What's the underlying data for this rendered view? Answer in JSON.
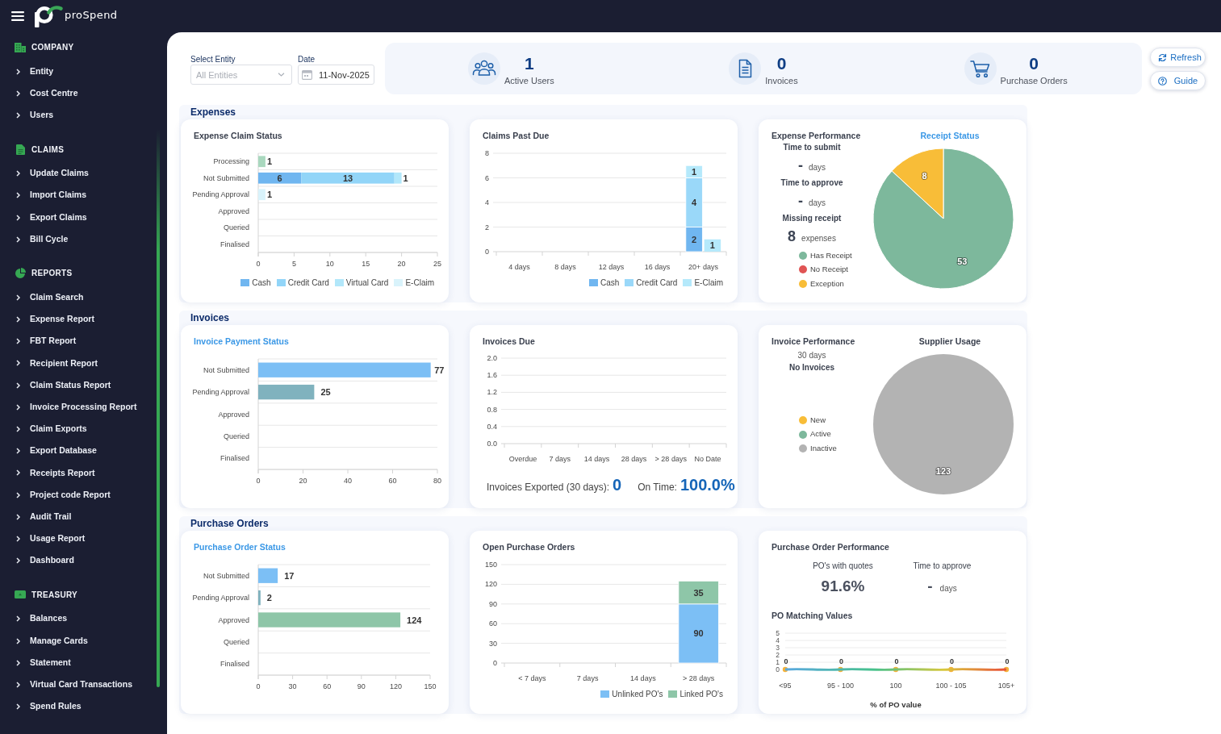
{
  "topbar": {
    "logo_text": "proSpend"
  },
  "sidebar": {
    "sections": [
      {
        "kind": "building",
        "title": "COMPANY",
        "items": [
          "Entity",
          "Cost Centre",
          "Users"
        ]
      },
      {
        "kind": "document",
        "title": "CLAIMS",
        "items": [
          "Update Claims",
          "Import Claims",
          "Export Claims",
          "Bill Cycle"
        ]
      },
      {
        "kind": "pie",
        "title": "REPORTS",
        "items": [
          "Claim Search",
          "Expense Report",
          "FBT Report",
          "Recipient Report",
          "Claim Status Report",
          "Invoice Processing Report",
          "Claim Exports",
          "Export Database",
          "Receipts Report",
          "Project code Report",
          "Audit Trail",
          "Usage Report",
          "Dashboard"
        ]
      },
      {
        "kind": "money",
        "title": "TREASURY",
        "items": [
          "Balances",
          "Manage Cards",
          "Statement",
          "Virtual Card Transactions",
          "Spend Rules"
        ]
      }
    ]
  },
  "filters": [
    {
      "kind": "select",
      "label": "Select Entity",
      "placeholder": "All Entities"
    },
    {
      "kind": "date",
      "label": "Date",
      "value": "11-Nov-2025"
    }
  ],
  "stats": [
    {
      "kind": "users",
      "value": "1",
      "label": "Active Users"
    },
    {
      "kind": "invoice",
      "value": "0",
      "label": "Invoices"
    },
    {
      "kind": "cart",
      "value": "0",
      "label": "Purchase Orders"
    }
  ],
  "actions": [
    {
      "kind": "refresh",
      "label": "Refresh"
    },
    {
      "kind": "help",
      "label": "Guide"
    }
  ],
  "sections": [
    {
      "title": "Expenses",
      "cards": [
        {
          "kind": "chart",
          "title": "Expense Claim Status",
          "linked": false,
          "chart_data": {
            "type": "bar",
            "orientation": "horizontal",
            "stacked": true,
            "categories": [
              "Processing",
              "Not Submitted",
              "Pending Approval",
              "Approved",
              "Queried",
              "Finalised"
            ],
            "series": [
              {
                "color": "#a9d8be",
                "values": [
                  1,
                  0,
                  0,
                  0,
                  0,
                  0
                ],
                "value_labels": [
                  "1",
                  null,
                  null,
                  null,
                  null,
                  null
                ]
              },
              {
                "name": "Cash",
                "color": "#70b6f0",
                "values": [
                  0,
                  6,
                  0,
                  0,
                  0,
                  0
                ],
                "value_labels": [
                  null,
                  "6",
                  null,
                  null,
                  null,
                  null
                ]
              },
              {
                "name": "Credit Card",
                "color": "#92d5f8",
                "values": [
                  0,
                  13,
                  0,
                  0,
                  0,
                  0
                ],
                "value_labels": [
                  null,
                  "13",
                  null,
                  null,
                  null,
                  null
                ]
              },
              {
                "name": "Virtual Card",
                "color": "#b2e7fa",
                "values": [
                  0,
                  1,
                  0,
                  0,
                  0,
                  0
                ],
                "value_labels": [
                  null,
                  "1",
                  null,
                  null,
                  null,
                  null
                ]
              },
              {
                "name": "E-Claim",
                "color": "#d9f3fb",
                "values": [
                  0,
                  0,
                  1,
                  0,
                  0,
                  0
                ],
                "value_labels": [
                  null,
                  null,
                  "1",
                  null,
                  null,
                  null
                ]
              }
            ],
            "xlim": [
              0,
              25
            ],
            "xticks": [
              0,
              5,
              10,
              15,
              20,
              25
            ],
            "grid": true,
            "legend": "bottom"
          }
        },
        {
          "kind": "chart",
          "title": "Claims Past Due",
          "linked": false,
          "chart_data": {
            "type": "bar",
            "orientation": "vertical",
            "stacked": true,
            "categories": [
              "4 days",
              "8 days",
              "12 days",
              "16 days",
              "20+ days"
            ],
            "series": [
              {
                "name": "Cash",
                "color": "#70b6f0",
                "values": [
                  0,
                  0,
                  0,
                  0,
                  2
                ],
                "value_labels": [
                  null,
                  null,
                  null,
                  null,
                  "2"
                ]
              },
              {
                "name": "Credit Card",
                "color": "#9ad8f9",
                "values": [
                  0,
                  0,
                  0,
                  0,
                  4
                ],
                "value_labels": [
                  null,
                  null,
                  null,
                  null,
                  "4"
                ]
              },
              {
                "name": "E-Claim",
                "color": "#b5e9fb",
                "values": [
                  0,
                  0,
                  0,
                  0,
                  1
                ],
                "value_labels": [
                  null,
                  null,
                  null,
                  null,
                  "1"
                ]
              }
            ],
            "annotations": [
              {
                "text": "1",
                "x": "20+ days",
                "y": 1
              }
            ],
            "ylim": [
              0,
              8
            ],
            "yticks": [
              0,
              2,
              4,
              6,
              8
            ],
            "grid": true,
            "legend": "bottom"
          }
        },
        {
          "kind": "split",
          "title": "Expense Performance",
          "lines": [
            {
              "kind": "label",
              "text": "Time to submit"
            },
            {
              "kind": "value",
              "value": "-",
              "unit": "days"
            },
            {
              "kind": "label",
              "text": "Time to approve"
            },
            {
              "kind": "value",
              "value": "-",
              "unit": "days"
            },
            {
              "kind": "label",
              "text": "Missing receipt"
            },
            {
              "kind": "value",
              "value": "8",
              "unit": "expenses"
            }
          ],
          "chart_title": "Receipt Status",
          "chart_linked": true,
          "chart_data": {
            "type": "pie",
            "categories": [
              "Has Receipt",
              "No Receipt",
              "Exception"
            ],
            "values": [
              53,
              0,
              8
            ],
            "colors": [
              "#7db89c",
              "#e05454",
              "#f8bd38"
            ],
            "value_labels": [
              "53",
              null,
              "8"
            ]
          }
        }
      ]
    },
    {
      "title": "Invoices",
      "cards": [
        {
          "kind": "chart",
          "title": "Invoice Payment Status",
          "linked": true,
          "chart_data": {
            "type": "bar",
            "orientation": "horizontal",
            "categories": [
              "Not Submitted",
              "Pending Approval",
              "Approved",
              "Queried",
              "Finalised"
            ],
            "values": [
              77,
              25,
              0,
              0,
              0
            ],
            "colors": [
              "#7cbff5",
              "#80b2be",
              null,
              null,
              null
            ],
            "value_labels": [
              "77",
              "25",
              null,
              null,
              null
            ],
            "xlim": [
              0,
              80
            ],
            "xticks": [
              0,
              20,
              40,
              60,
              80
            ],
            "grid": true
          }
        },
        {
          "kind": "chart",
          "title": "Invoices Due",
          "linked": false,
          "chart_data": {
            "type": "bar",
            "orientation": "vertical",
            "categories": [
              "Overdue",
              "7 days",
              "14 days",
              "28 days",
              "> 28 days",
              "No Date"
            ],
            "values": [
              0,
              0,
              0,
              0,
              0,
              0
            ],
            "ylim": [
              0,
              2
            ],
            "yticks": [
              {
                "value": 0,
                "label": "0.0"
              },
              {
                "value": 0.4,
                "label": "0.4"
              },
              {
                "value": 0.8,
                "label": "0.8"
              },
              {
                "value": 1.2,
                "label": "1.2"
              },
              {
                "value": 1.6,
                "label": "1.6"
              },
              {
                "value": 2,
                "label": "2.0"
              }
            ],
            "grid": true
          },
          "footer": [
            {
              "label": "Invoices Exported (30 days):",
              "value": "0"
            },
            {
              "label": "On Time:",
              "value": "100.0%"
            }
          ]
        },
        {
          "kind": "split",
          "title": "Invoice Performance",
          "lines": [
            {
              "kind": "note",
              "text": "30 days"
            },
            {
              "kind": "label",
              "text": "No Invoices"
            }
          ],
          "chart_title": "Supplier Usage",
          "chart_linked": false,
          "chart_data": {
            "type": "pie",
            "categories": [
              "New",
              "Active",
              "Inactive"
            ],
            "values": [
              0,
              0,
              123
            ],
            "colors": [
              "#f8bd38",
              "#7db89c",
              "#b3b3b3"
            ],
            "value_labels": [
              null,
              null,
              "123"
            ]
          }
        }
      ]
    },
    {
      "title": "Purchase Orders",
      "cards": [
        {
          "kind": "chart",
          "title": "Purchase Order Status",
          "linked": true,
          "chart_data": {
            "type": "bar",
            "orientation": "horizontal",
            "categories": [
              "Not Submitted",
              "Pending Approval",
              "Approved",
              "Queried",
              "Finalised"
            ],
            "values": [
              17,
              2,
              124,
              0,
              0
            ],
            "colors": [
              "#7cbff5",
              "#80b2be",
              "#8ec6a8",
              null,
              null
            ],
            "value_labels": [
              "17",
              "2",
              "124",
              null,
              null
            ],
            "xlim": [
              0,
              150
            ],
            "xticks": [
              0,
              30,
              60,
              90,
              120,
              150
            ],
            "grid": true
          }
        },
        {
          "kind": "chart",
          "title": "Open Purchase Orders",
          "linked": false,
          "chart_data": {
            "type": "bar",
            "orientation": "vertical",
            "stacked": true,
            "categories": [
              "< 7 days",
              "7 days",
              "14 days",
              "> 28 days"
            ],
            "series": [
              {
                "name": "Unlinked PO's",
                "color": "#7cbff5",
                "values": [
                  0,
                  0,
                  0,
                  90
                ],
                "value_labels": [
                  null,
                  null,
                  null,
                  "90"
                ]
              },
              {
                "name": "Linked PO's",
                "color": "#8ec6a8",
                "values": [
                  0,
                  0,
                  0,
                  35
                ],
                "value_labels": [
                  null,
                  null,
                  null,
                  "35"
                ]
              }
            ],
            "ylim": [
              0,
              150
            ],
            "yticks": [
              0,
              30,
              60,
              90,
              120,
              150
            ],
            "grid": true,
            "legend": "bottom"
          }
        },
        {
          "kind": "metrics_line",
          "title": "Purchase Order Performance",
          "metrics": [
            {
              "label": "PO's with quotes",
              "value": "91.6%"
            },
            {
              "label": "Time to approve",
              "value": "-",
              "unit": "days"
            }
          ],
          "subtitle": "PO Matching Values",
          "chart_data": {
            "type": "line",
            "categories": [
              "<95",
              "95 - 100",
              "100",
              "100 - 105",
              "105+"
            ],
            "values": [
              0,
              0,
              0,
              0,
              0
            ],
            "value_labels": [
              "0",
              "0",
              "0",
              "0",
              "0"
            ],
            "marker": "circle",
            "ylim": [
              0,
              5
            ],
            "yticks": [
              0,
              1,
              2,
              3,
              4,
              5
            ],
            "xlabel": "% of PO value",
            "grid": true
          }
        }
      ]
    }
  ]
}
